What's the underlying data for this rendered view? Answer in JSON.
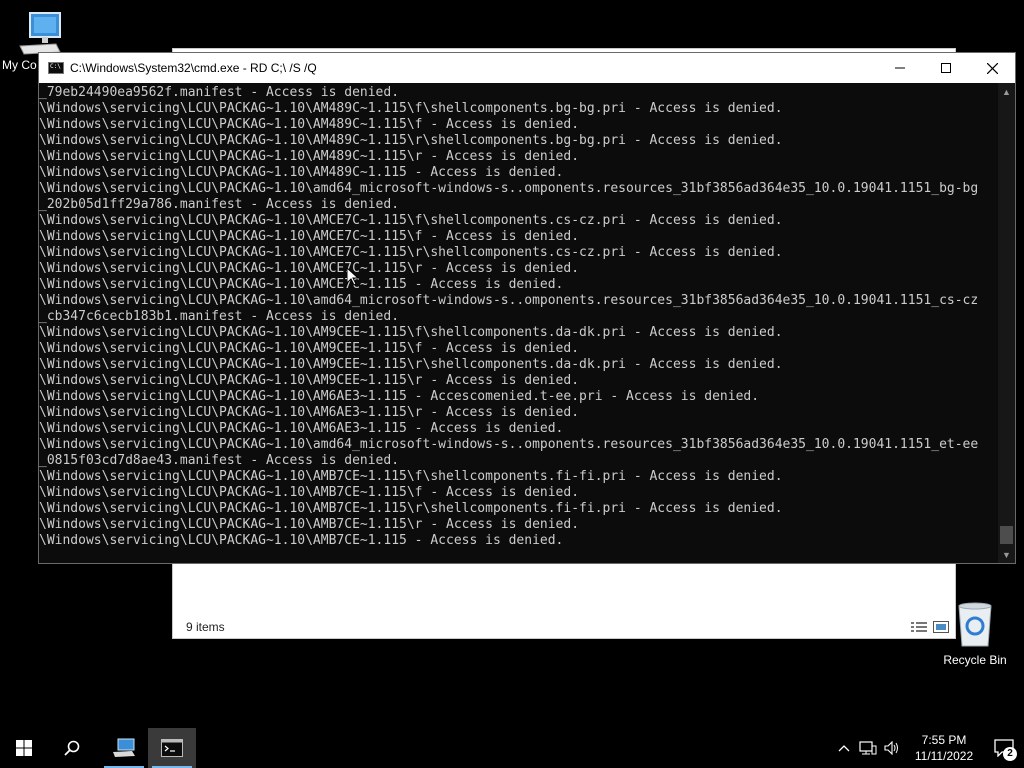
{
  "desktop": {
    "my_computer_label": "My Co",
    "recycle_bin_label": "Recycle Bin"
  },
  "explorer": {
    "item_count": "9 items"
  },
  "cmd": {
    "title": "C:\\Windows\\System32\\cmd.exe - RD  C;\\ /S /Q",
    "lines": [
      "_79eb24490ea9562f.manifest - Access is denied.",
      "\\Windows\\servicing\\LCU\\PACKAG~1.10\\AM489C~1.115\\f\\shellcomponents.bg-bg.pri - Access is denied.",
      "\\Windows\\servicing\\LCU\\PACKAG~1.10\\AM489C~1.115\\f - Access is denied.",
      "\\Windows\\servicing\\LCU\\PACKAG~1.10\\AM489C~1.115\\r\\shellcomponents.bg-bg.pri - Access is denied.",
      "\\Windows\\servicing\\LCU\\PACKAG~1.10\\AM489C~1.115\\r - Access is denied.",
      "\\Windows\\servicing\\LCU\\PACKAG~1.10\\AM489C~1.115 - Access is denied.",
      "\\Windows\\servicing\\LCU\\PACKAG~1.10\\amd64_microsoft-windows-s..omponents.resources_31bf3856ad364e35_10.0.19041.1151_bg-bg",
      "_202b05d1ff29a786.manifest - Access is denied.",
      "\\Windows\\servicing\\LCU\\PACKAG~1.10\\AMCE7C~1.115\\f\\shellcomponents.cs-cz.pri - Access is denied.",
      "\\Windows\\servicing\\LCU\\PACKAG~1.10\\AMCE7C~1.115\\f - Access is denied.",
      "\\Windows\\servicing\\LCU\\PACKAG~1.10\\AMCE7C~1.115\\r\\shellcomponents.cs-cz.pri - Access is denied.",
      "\\Windows\\servicing\\LCU\\PACKAG~1.10\\AMCE7C~1.115\\r - Access is denied.",
      "\\Windows\\servicing\\LCU\\PACKAG~1.10\\AMCE7C~1.115 - Access is denied.",
      "\\Windows\\servicing\\LCU\\PACKAG~1.10\\amd64_microsoft-windows-s..omponents.resources_31bf3856ad364e35_10.0.19041.1151_cs-cz",
      "_cb347c6cecb183b1.manifest - Access is denied.",
      "\\Windows\\servicing\\LCU\\PACKAG~1.10\\AM9CEE~1.115\\f\\shellcomponents.da-dk.pri - Access is denied.",
      "\\Windows\\servicing\\LCU\\PACKAG~1.10\\AM9CEE~1.115\\f - Access is denied.",
      "\\Windows\\servicing\\LCU\\PACKAG~1.10\\AM9CEE~1.115\\r\\shellcomponents.da-dk.pri - Access is denied.",
      "\\Windows\\servicing\\LCU\\PACKAG~1.10\\AM9CEE~1.115\\r - Access is denied.",
      "\\Windows\\servicing\\LCU\\PACKAG~1.10\\AM6AE3~1.115 - Accescomenied.t-ee.pri - Access is denied.",
      "\\Windows\\servicing\\LCU\\PACKAG~1.10\\AM6AE3~1.115\\r - Access is denied.",
      "\\Windows\\servicing\\LCU\\PACKAG~1.10\\AM6AE3~1.115 - Access is denied.",
      "\\Windows\\servicing\\LCU\\PACKAG~1.10\\amd64_microsoft-windows-s..omponents.resources_31bf3856ad364e35_10.0.19041.1151_et-ee",
      "_0815f03cd7d8ae43.manifest - Access is denied.",
      "\\Windows\\servicing\\LCU\\PACKAG~1.10\\AMB7CE~1.115\\f\\shellcomponents.fi-fi.pri - Access is denied.",
      "\\Windows\\servicing\\LCU\\PACKAG~1.10\\AMB7CE~1.115\\f - Access is denied.",
      "\\Windows\\servicing\\LCU\\PACKAG~1.10\\AMB7CE~1.115\\r\\shellcomponents.fi-fi.pri - Access is denied.",
      "\\Windows\\servicing\\LCU\\PACKAG~1.10\\AMB7CE~1.115\\r - Access is denied.",
      "\\Windows\\servicing\\LCU\\PACKAG~1.10\\AMB7CE~1.115 - Access is denied."
    ]
  },
  "taskbar": {
    "time": "7:55 PM",
    "date": "11/11/2022",
    "notification_count": "2"
  },
  "colors": {
    "console_bg": "#0c0c0c",
    "console_text": "#cccccc",
    "taskbar_bg": "#000000",
    "active_indicator": "#76b9ed"
  }
}
